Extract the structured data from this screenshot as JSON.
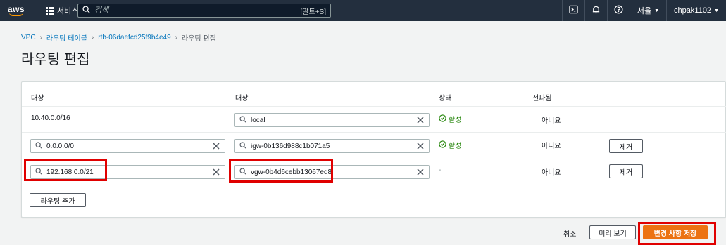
{
  "nav": {
    "logo": "aws",
    "services_label": "서비스",
    "search_placeholder": "검색",
    "search_shortcut": "[알트+S]",
    "region": "서울",
    "account": "chpak1102"
  },
  "breadcrumb": {
    "items": [
      "VPC",
      "라우팅 테이블",
      "rtb-06daefcd25f9b4e49"
    ],
    "current": "라우팅 편집"
  },
  "page_title": "라우팅 편집",
  "table": {
    "headers": [
      "대상",
      "대상",
      "상태",
      "전파됨"
    ],
    "rows": [
      {
        "destination": "10.40.0.0/16",
        "target": "local",
        "status": "활성",
        "propagated": "아니요"
      },
      {
        "destination": "0.0.0.0/0",
        "target": "igw-0b136d988c1b071a5",
        "status": "활성",
        "propagated": "아니요",
        "remove_label": "제거"
      },
      {
        "destination": "192.168.0.0/21",
        "target": "vgw-0b4d6cebb13067ed8",
        "status": "-",
        "propagated": "아니요",
        "remove_label": "제거"
      }
    ],
    "add_route_label": "라우팅 추가"
  },
  "footer": {
    "cancel_label": "취소",
    "preview_label": "미리 보기",
    "save_label": "변경 사항 저장"
  },
  "colors": {
    "nav_bg": "#232f3e",
    "link": "#0073bb",
    "success": "#1d8102",
    "primary": "#ec7211",
    "highlight": "#e00000"
  }
}
